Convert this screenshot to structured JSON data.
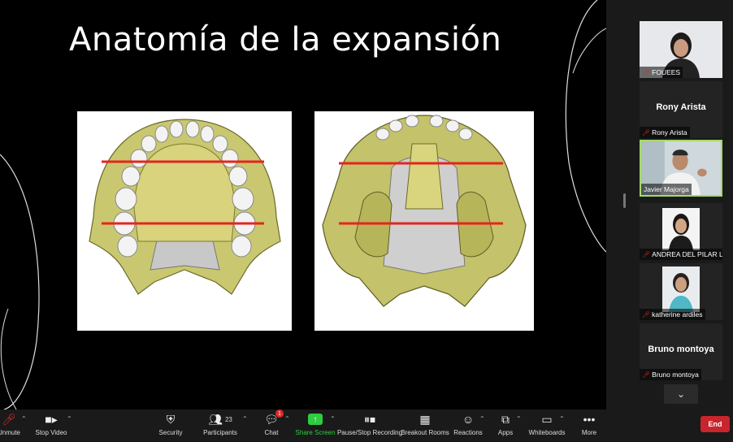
{
  "slide": {
    "title": "Anatomía de la expansión"
  },
  "participants": [
    {
      "name": "FOUEES",
      "muted": true,
      "type": "video"
    },
    {
      "name": "Rony Arista",
      "muted": true,
      "type": "name-only",
      "center_name": "Rony Arista"
    },
    {
      "name": "Javier Majorga",
      "muted": false,
      "type": "video",
      "active_speaker": true
    },
    {
      "name": "ANDREA DEL PILAR LEIV...",
      "muted": true,
      "type": "video"
    },
    {
      "name": "katherine ardiles",
      "muted": true,
      "type": "video"
    },
    {
      "name": "Bruno montoya",
      "muted": true,
      "type": "name-only",
      "center_name": "Bruno montoya"
    }
  ],
  "toolbar": {
    "unmute": "Unmute",
    "stop_video": "Stop Video",
    "security": "Security",
    "participants": "Participants",
    "participants_count": "23",
    "chat": "Chat",
    "chat_badge": "1",
    "share_screen": "Share Screen",
    "pause_recording": "Pause/Stop Recording",
    "breakout_rooms": "Breakout Rooms",
    "reactions": "Reactions",
    "apps": "Apps",
    "whiteboards": "Whiteboards",
    "more": "More",
    "end": "End"
  },
  "colors": {
    "share_green": "#2ecc40",
    "end_red": "#c9252c",
    "active_border": "#a6d96a",
    "muted_red": "#e02828"
  }
}
